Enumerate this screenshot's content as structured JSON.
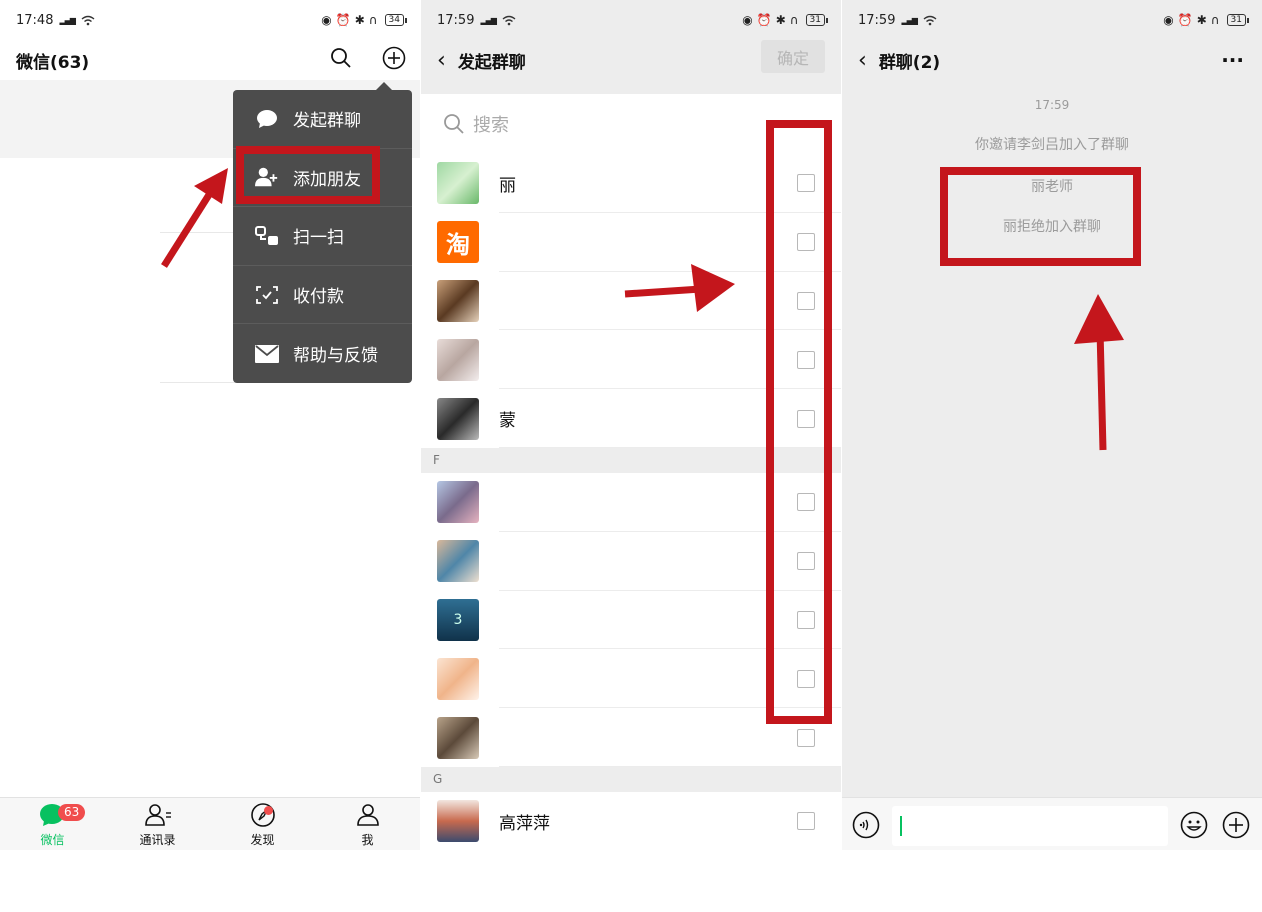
{
  "panel1": {
    "status": {
      "time": "17:48",
      "network": "4G",
      "battery": "34"
    },
    "title": "微信(63)",
    "menu": [
      {
        "label": "发起群聊",
        "icon": "chat-bubble-icon"
      },
      {
        "label": "添加朋友",
        "icon": "add-friend-icon"
      },
      {
        "label": "扫一扫",
        "icon": "scan-icon"
      },
      {
        "label": "收付款",
        "icon": "payment-icon"
      },
      {
        "label": "帮助与反馈",
        "icon": "mail-icon"
      }
    ],
    "tabs": [
      {
        "label": "微信",
        "icon": "chat-icon",
        "badge": "63"
      },
      {
        "label": "通讯录",
        "icon": "contacts-icon"
      },
      {
        "label": "发现",
        "icon": "compass-icon"
      },
      {
        "label": "我",
        "icon": "person-icon"
      }
    ]
  },
  "panel2": {
    "status": {
      "time": "17:59",
      "network": "4G",
      "battery": "31"
    },
    "title": "发起群聊",
    "confirm_label": "确定",
    "search_placeholder": "搜索",
    "contacts_top": [
      {
        "name": "丽"
      },
      {
        "name": ""
      },
      {
        "name": ""
      },
      {
        "name": ""
      },
      {
        "name": "蒙"
      }
    ],
    "section_f": "F",
    "contacts_f": [
      {
        "name": ""
      },
      {
        "name": ""
      },
      {
        "name": ""
      },
      {
        "name": ""
      },
      {
        "name": ""
      }
    ],
    "section_g": "G",
    "contacts_g": [
      {
        "name": "高萍萍"
      }
    ]
  },
  "panel3": {
    "status": {
      "time": "17:59",
      "network": "4G",
      "battery": "31"
    },
    "title": "群聊(2)",
    "more_label": "···",
    "timestamp": "17:59",
    "system_messages": [
      "你邀请李剑吕加入了群聊",
      "丽老师",
      "丽拒绝加入群聊"
    ]
  },
  "colors": {
    "accent_green": "#07c160",
    "annotation_red": "#c4161c",
    "menu_bg": "#4c4c4c",
    "badge_red": "#f04d4d"
  }
}
